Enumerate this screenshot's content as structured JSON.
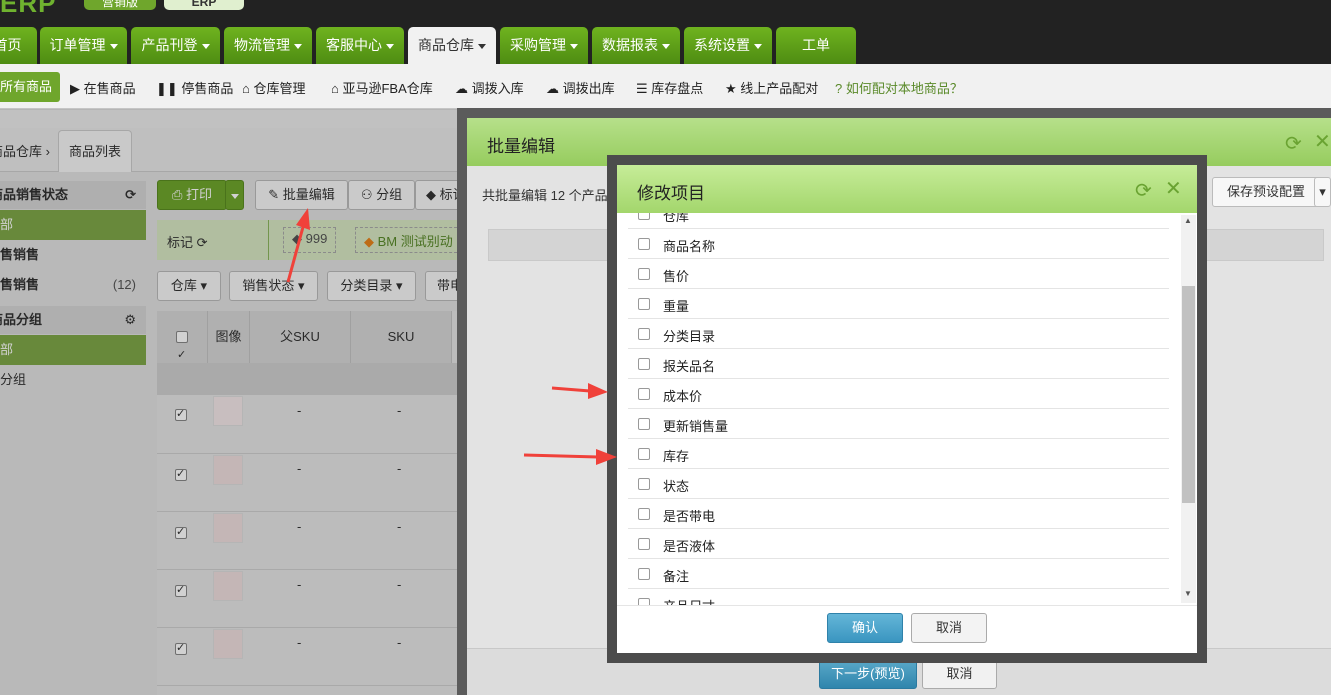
{
  "header": {
    "logo": "ERP",
    "version_tabs": [
      "营销版",
      "ERP"
    ]
  },
  "main_nav": {
    "items": [
      {
        "label": "首页",
        "active": false
      },
      {
        "label": "订单管理",
        "active": false
      },
      {
        "label": "产品刊登",
        "active": false
      },
      {
        "label": "物流管理",
        "active": false
      },
      {
        "label": "客服中心",
        "active": false
      },
      {
        "label": "商品仓库",
        "active": true
      },
      {
        "label": "采购管理",
        "active": false
      },
      {
        "label": "数据报表",
        "active": false
      },
      {
        "label": "系统设置",
        "active": false
      },
      {
        "label": "工单",
        "active": false
      }
    ]
  },
  "sub_nav": {
    "all_label": "所有商品",
    "items": [
      "在售商品",
      "停售商品",
      "仓库管理",
      "亚马逊FBA仓库",
      "调拨入库",
      "调拨出库",
      "库存盘点",
      "线上产品配对"
    ],
    "help_link": "如何配对本地商品？"
  },
  "breadcrumb": {
    "parent": "商品仓库",
    "current": "商品列表"
  },
  "sidebar": {
    "sale_status_title": "商品销售状态",
    "status_items": [
      {
        "label": "全部",
        "count": ""
      },
      {
        "label": "在售销售",
        "count": ""
      },
      {
        "label": "停售销售",
        "count": "(12)"
      }
    ],
    "group_title": "商品分组",
    "group_items": [
      {
        "label": "全部"
      },
      {
        "label": "未分组"
      }
    ]
  },
  "toolbar": {
    "print": "打印",
    "batch_edit": "批量编辑",
    "group": "分组",
    "mark": "标记"
  },
  "tag_bar": {
    "label": "标记",
    "tag1": "999",
    "tag2": "BM 测试别动"
  },
  "filters": [
    "仓库",
    "销售状态",
    "分类目录",
    "带电"
  ],
  "table": {
    "columns": [
      "图像",
      "父SKU",
      "SKU"
    ],
    "rows": [
      {
        "parent_sku": "-",
        "sku": "-"
      },
      {
        "parent_sku": "-",
        "sku": "-"
      },
      {
        "parent_sku": "-",
        "sku": "-"
      },
      {
        "parent_sku": "-",
        "sku": "-"
      },
      {
        "parent_sku": "-",
        "sku": "-"
      }
    ]
  },
  "batch_modal": {
    "title": "批量编辑",
    "count_text": "共批量编辑 12 个产品",
    "save_preset": "保存预设配置",
    "next_button": "下一步(预览)",
    "cancel_button": "取消"
  },
  "field_modal": {
    "title": "修改项目",
    "items": [
      "仓库",
      "商品名称",
      "售价",
      "重量",
      "分类目录",
      "报关品名",
      "成本价",
      "更新销售量",
      "库存",
      "状态",
      "是否带电",
      "是否液体",
      "备注",
      "产品尺寸"
    ],
    "confirm": "确认",
    "cancel": "取消"
  },
  "colors": {
    "nav_green": "#5a9a16",
    "modal_header": "#a3d66c",
    "primary_blue": "#3a95c0",
    "annotation_red": "#f0413a"
  }
}
